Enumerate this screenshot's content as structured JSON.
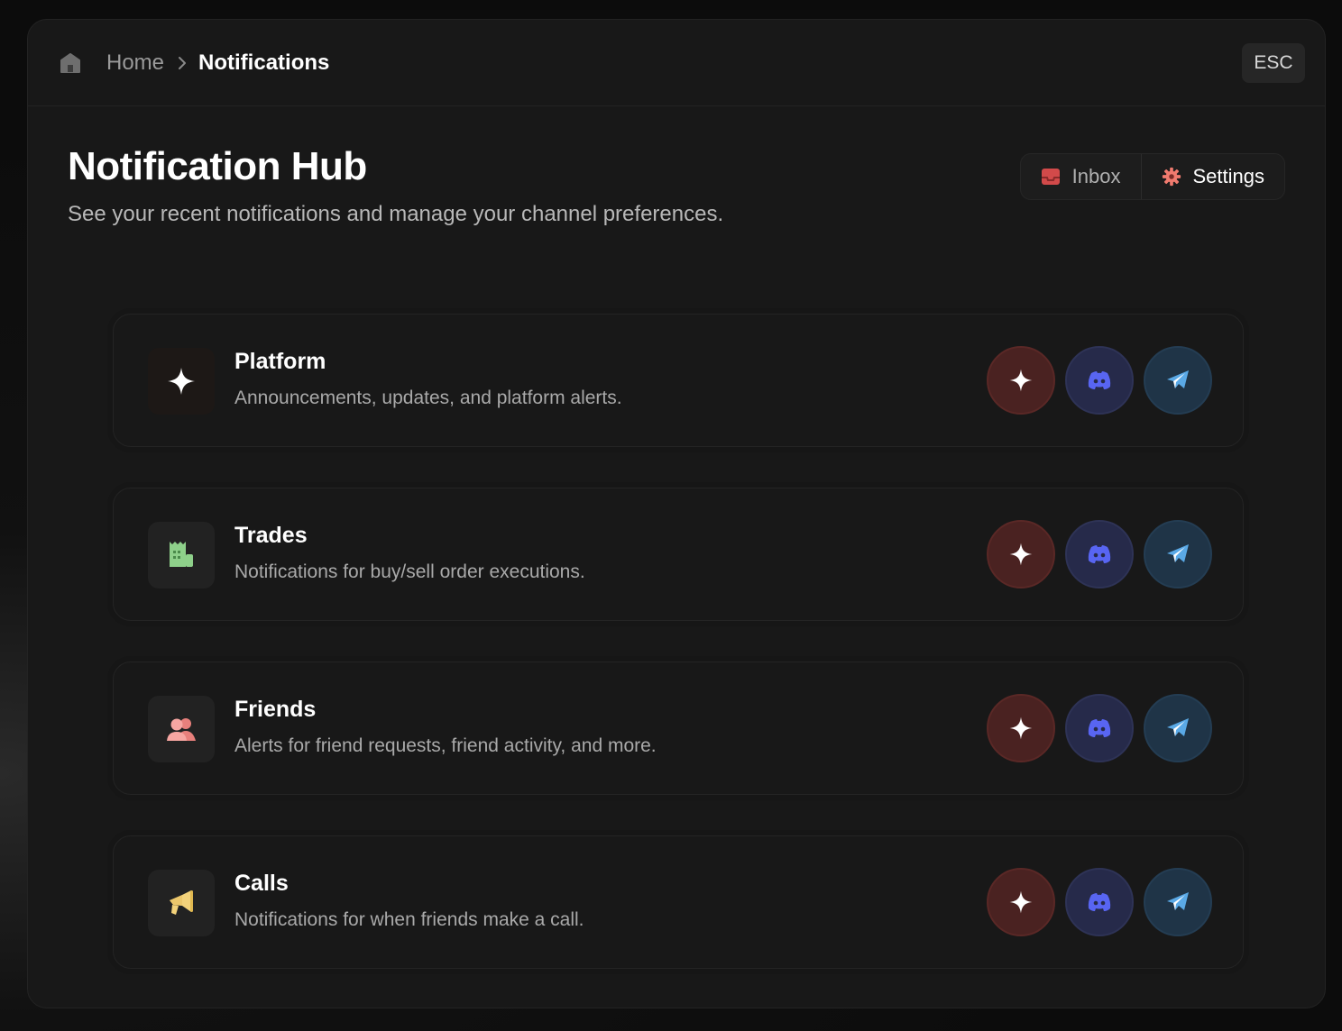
{
  "breadcrumb": {
    "home_icon": "home-icon",
    "home_label": "Home",
    "separator_icon": "chevron-right-icon",
    "current_label": "Notifications"
  },
  "esc_label": "ESC",
  "header": {
    "title": "Notification Hub",
    "subtitle": "See your recent notifications and manage your channel preferences."
  },
  "tabs": [
    {
      "label": "Inbox",
      "icon": "inbox-icon",
      "selected": false
    },
    {
      "label": "Settings",
      "icon": "gear-icon",
      "selected": true
    }
  ],
  "categories": [
    {
      "title": "Platform",
      "description": "Announcements, updates, and platform alerts.",
      "icon": "sparkle-icon"
    },
    {
      "title": "Trades",
      "description": "Notifications for buy/sell order executions.",
      "icon": "receipt-icon"
    },
    {
      "title": "Friends",
      "description": "Alerts for friend requests, friend activity, and more.",
      "icon": "people-icon"
    },
    {
      "title": "Calls",
      "description": "Notifications for when friends make a call.",
      "icon": "megaphone-icon"
    }
  ],
  "channels": [
    {
      "id": "app",
      "icon": "sparkle-icon",
      "color": "#4a2221"
    },
    {
      "id": "discord",
      "icon": "discord-icon",
      "color": "#262a4a"
    },
    {
      "id": "telegram",
      "icon": "telegram-icon",
      "color": "#1f3447"
    }
  ],
  "colors": {
    "background": "#181818",
    "discord_accent": "#5865f2",
    "telegram_accent": "#5aa9e6"
  }
}
